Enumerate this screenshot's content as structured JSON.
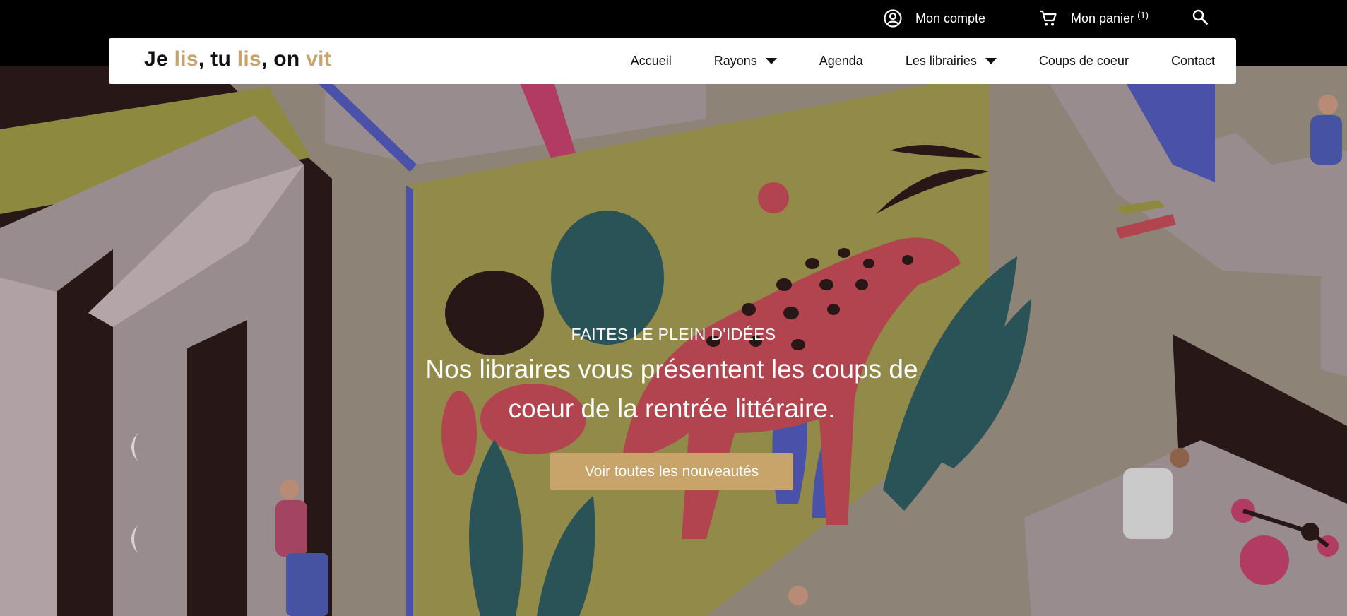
{
  "topbar": {
    "account_label": "Mon compte",
    "account_icon": "user-circle-icon",
    "cart_label": "Mon panier",
    "cart_count": "(1)",
    "cart_icon": "cart-icon",
    "search_icon": "search-icon"
  },
  "brand": {
    "w1": "Je",
    "w2": "lis",
    "sep1": ",",
    "w3": "tu",
    "w4": "lis",
    "sep2": ",",
    "w5": "on",
    "w6": "vit"
  },
  "nav": {
    "items": [
      {
        "label": "Accueil"
      },
      {
        "label": "Rayons"
      },
      {
        "label": "Agenda"
      },
      {
        "label": "Les librairies"
      },
      {
        "label": "Coups de coeur"
      },
      {
        "label": "Contact"
      }
    ]
  },
  "hero": {
    "kicker": "FAITES LE PLEIN D'IDÉES",
    "headline": "Nos libraires vous présentent les coups de coeur de la rentrée littéraire.",
    "cta_label": "Voir toutes les nouveautés"
  },
  "colors": {
    "accent": "#c8a36a",
    "topbar_bg": "#000000",
    "navbar_bg": "#ffffff"
  }
}
